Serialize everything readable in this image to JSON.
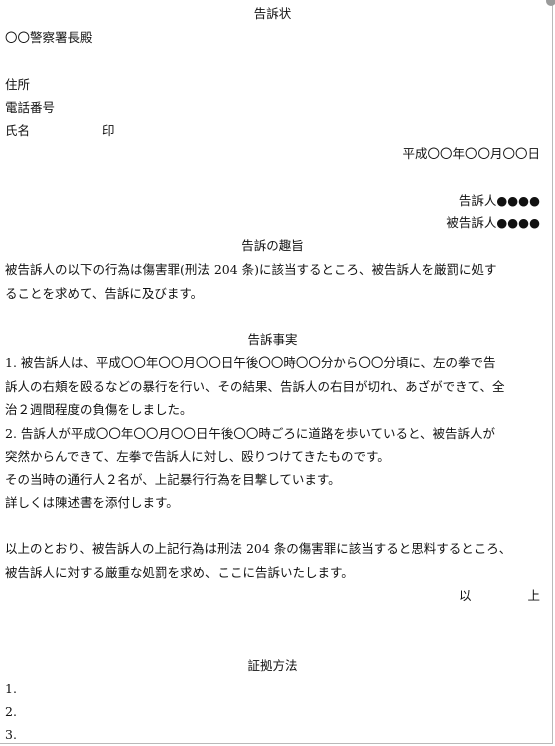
{
  "document": {
    "title": "告訴状",
    "addressee": "〇〇警察署長殿",
    "complainant_info": {
      "address_label": "住所",
      "phone_label": "電話番号",
      "name_label": "氏名",
      "seal_label": "印"
    },
    "date": "平成〇〇年〇〇月〇〇日",
    "parties": {
      "complainant_label": "告訴人",
      "complainant_name": "●●●●",
      "defendant_label": "被告訴人",
      "defendant_name": "●●●●"
    },
    "purpose": {
      "heading": "告訴の趣旨",
      "lines": [
        "被告訴人の以下の行為は傷害罪(刑法 204 条)に該当するところ、被告訴人を厳罰に処す",
        "ることを求めて、告訴に及びます。"
      ]
    },
    "facts": {
      "heading": "告訴事実",
      "lines": [
        "1. 被告訴人は、平成〇〇年〇〇月〇〇日午後〇〇時〇〇分から〇〇分頃に、左の拳で告",
        "訴人の右頬を殴るなどの暴行を行い、その結果、告訴人の右目が切れ、あざができて、全",
        "治２週間程度の負傷をしました。",
        "2. 告訴人が平成〇〇年〇〇月〇〇日午後〇〇時ごろに道路を歩いていると、被告訴人が",
        "突然からんできて、左拳で告訴人に対し、殴りつけてきたものです。",
        "その当時の通行人２名が、上記暴行行為を目撃しています。",
        "詳しくは陳述書を添付します。"
      ]
    },
    "conclusion": {
      "lines": [
        "以上のとおり、被告訴人の上記行為は刑法 204 条の傷害罪に該当すると思料するところ、",
        "被告訴人に対する厳重な処罰を求め、ここに告訴いたします。"
      ],
      "closing_left": "以",
      "closing_right": "上"
    },
    "evidence": {
      "heading": "証拠方法",
      "items": [
        "1.",
        "2.",
        "3."
      ]
    }
  }
}
